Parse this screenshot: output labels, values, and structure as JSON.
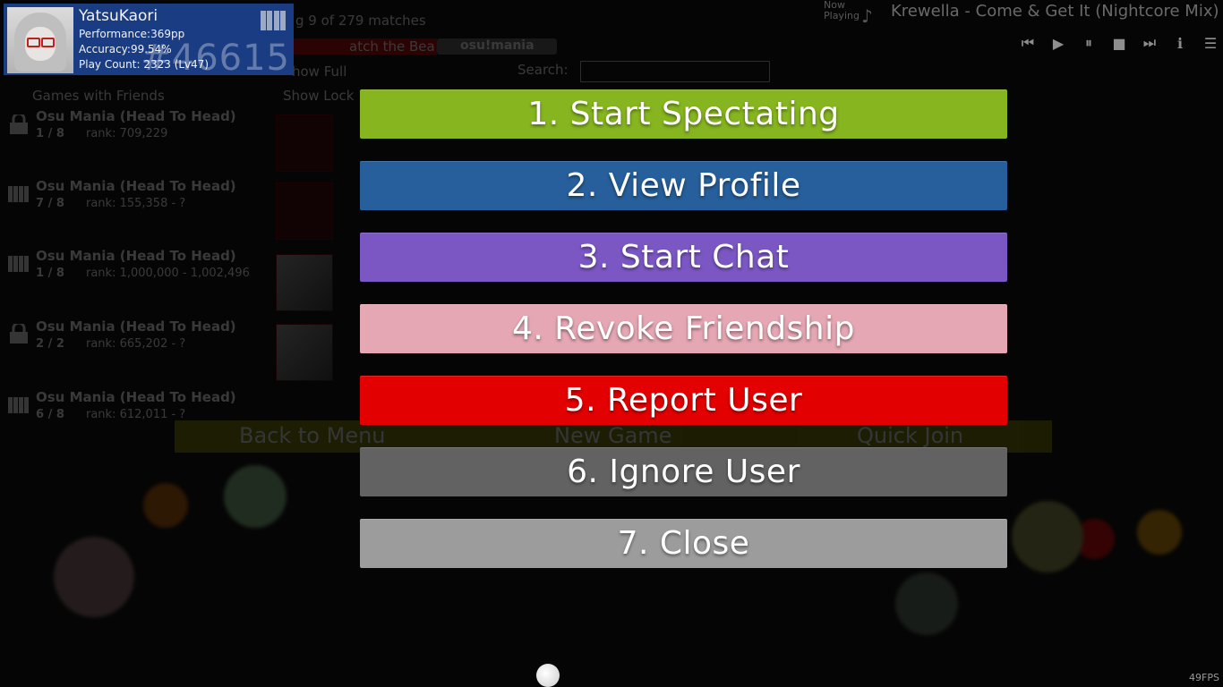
{
  "user_card": {
    "username": "YatsuKaori",
    "performance": "Performance:369pp",
    "accuracy": "Accuracy:99.54%",
    "play_count": "Play Count: 2323 (Lv47)",
    "rank": "#46615",
    "mode_icon": "mania-keys-icon"
  },
  "now_playing": {
    "label_line1": "Now",
    "label_line2": "Playing",
    "title": "Krewella - Come & Get It (Nightcore Mix)"
  },
  "lobby": {
    "matches_text": "g 9 of 279 matches",
    "filter_text": "atch the Bea",
    "mode_tab": "osu!mania",
    "search_label": "Search:",
    "show_full": "how Full",
    "show_locked": "Show Lock",
    "games_with_friends": "Games with Friends",
    "rows": [
      {
        "title": "Osu Mania (Head To Head)",
        "players": "1 / 8",
        "rank": "rank: 709,229"
      },
      {
        "title": "Osu Mania (Head To Head)",
        "players": "7 / 8",
        "rank": "rank: 155,358 - ?"
      },
      {
        "title": "Osu Mania (Head To Head)",
        "players": "1 / 8",
        "rank": "rank: 1,000,000 - 1,002,496"
      },
      {
        "title": "Osu Mania (Head To Head)",
        "players": "2 / 2",
        "rank": "rank: 665,202 - ?"
      },
      {
        "title": "Osu Mania (Head To Head)",
        "players": "6 / 8",
        "rank": "rank: 612,011 - ?"
      }
    ],
    "back_to_menu": "Back to Menu",
    "new_game": "New Game",
    "quick_join": "Quick Join"
  },
  "menu": {
    "items": [
      {
        "label": "1. Start Spectating",
        "color": "#86b51f"
      },
      {
        "label": "2. View Profile",
        "color": "#265f9b"
      },
      {
        "label": "3. Start Chat",
        "color": "#7b57c4"
      },
      {
        "label": "4. Revoke Friendship",
        "color": "#e5a7b3"
      },
      {
        "label": "5. Report User",
        "color": "#e30000"
      },
      {
        "label": "6. Ignore User",
        "color": "#626262"
      },
      {
        "label": "7. Close",
        "color": "#9c9c9c"
      }
    ]
  },
  "fps": "49FPS"
}
